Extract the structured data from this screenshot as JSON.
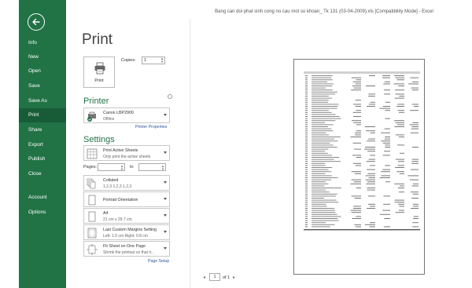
{
  "window": {
    "title": "Bang can doi phat sinh cong no cau mot so khoan_ Tk 131 (03-04-2009).xls  [Compatibility Mode] - Excel"
  },
  "nav": {
    "items": [
      {
        "label": "Info"
      },
      {
        "label": "New"
      },
      {
        "label": "Open"
      },
      {
        "label": "Save"
      },
      {
        "label": "Save As"
      },
      {
        "label": "Print"
      },
      {
        "label": "Share"
      },
      {
        "label": "Export"
      },
      {
        "label": "Publish"
      },
      {
        "label": "Close"
      },
      {
        "label": "Account"
      },
      {
        "label": "Options"
      }
    ],
    "active": "Print"
  },
  "print": {
    "title": "Print",
    "button_label": "Print",
    "copies_label": "Copies:",
    "copies_value": "1"
  },
  "printer": {
    "section": "Printer",
    "name": "Canon LBP2900",
    "status": "Offline",
    "properties_link": "Printer Properties"
  },
  "settings": {
    "section": "Settings",
    "what": {
      "title": "Print Active Sheets",
      "sub": "Only print the active sheets"
    },
    "pages_label": "Pages:",
    "to_label": "to",
    "collate": {
      "title": "Collated",
      "sub": "1,2,3    1,2,3    1,2,3"
    },
    "orientation": {
      "title": "Portrait Orientation"
    },
    "paper": {
      "title": "A4",
      "sub": "21 cm x 29.7 cm"
    },
    "margins": {
      "title": "Last Custom Margins Setting",
      "sub": "Left:  1.5 cm    Right:  0.8 cm"
    },
    "scaling": {
      "title": "Fit Sheet on One Page",
      "sub": "Shrink the printout so that it..."
    },
    "page_setup_link": "Page Setup"
  },
  "preview": {
    "page_value": "1",
    "page_total": "of 1"
  },
  "colors": {
    "brand": "#217346",
    "brand_dark": "#185c37",
    "link": "#2b579a"
  }
}
